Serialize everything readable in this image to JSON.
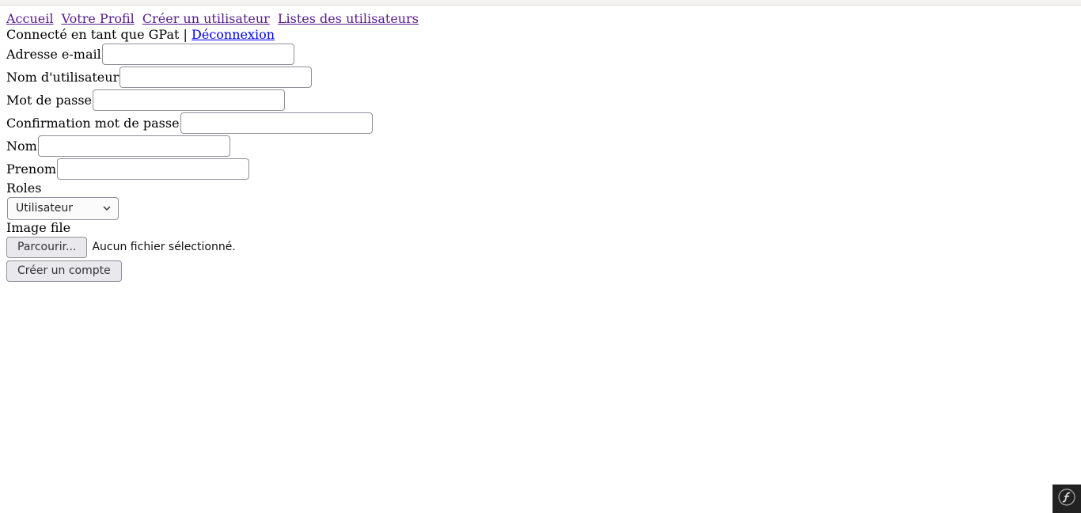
{
  "nav": {
    "links": [
      "Accueil",
      "Votre Profil",
      "Créer un utilisateur",
      "Listes des utilisateurs"
    ]
  },
  "status": {
    "prefix": "Connecté en tant que GPat |",
    "logout": "Déconnexion"
  },
  "form": {
    "email_label": "Adresse e-mail",
    "email_value": "",
    "username_label": "Nom d'utilisateur",
    "username_value": "",
    "password_label": "Mot de passe",
    "password_value": "",
    "password_confirm_label": "Confirmation mot de passe",
    "password_confirm_value": "",
    "lastname_label": "Nom",
    "lastname_value": "",
    "firstname_label": "Prenom",
    "firstname_value": "",
    "roles_label": "Roles",
    "roles_selected": "Utilisateur",
    "image_label": "Image file",
    "browse_button": "Parcourir...",
    "file_status": "Aucun fichier sélectionné.",
    "submit_button": "Créer un compte"
  },
  "icons": {
    "select_arrow": "chevron-down-icon",
    "debug_toolbar": "symfony-logo-icon"
  },
  "colors": {
    "visited_link": "#551a8b",
    "link": "#0000ee",
    "toolbar_bg": "#222222"
  }
}
